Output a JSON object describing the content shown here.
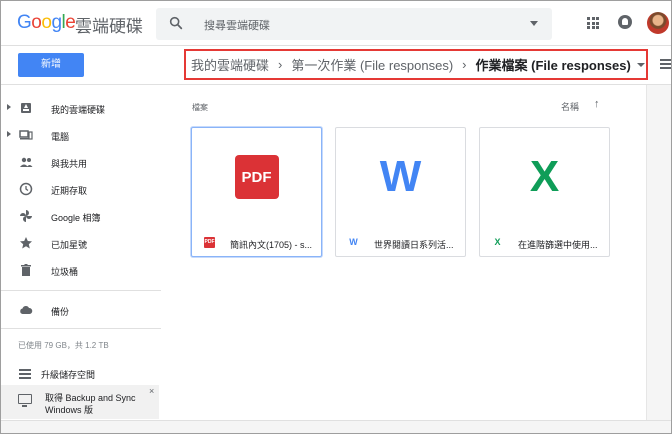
{
  "header": {
    "logo": "Google",
    "product": "雲端硬碟",
    "search_placeholder": "搜尋雲端硬碟"
  },
  "toolbar": {
    "new_label": "新增"
  },
  "breadcrumb": {
    "items": [
      "我的雲端硬碟",
      "第一次作業 (File responses)"
    ],
    "separator": "›",
    "current": "作業檔案 (File responses)"
  },
  "sidebar": {
    "items": [
      {
        "label": "我的雲端硬碟",
        "icon": "drive-icon"
      },
      {
        "label": "電腦",
        "icon": "computer-icon"
      },
      {
        "label": "與我共用",
        "icon": "shared-people-icon"
      },
      {
        "label": "近期存取",
        "icon": "clock-icon"
      },
      {
        "label": "Google 相簿",
        "icon": "photos-pinwheel-icon"
      },
      {
        "label": "已加星號",
        "icon": "star-icon"
      },
      {
        "label": "垃圾桶",
        "icon": "trash-icon"
      }
    ],
    "backup_label": "備份",
    "storage_usage": "已使用 79 GB，共 1.2 TB",
    "upgrade_label": "升級儲存空間",
    "promo_line1": "取得 Backup and Sync",
    "promo_line2": "Windows 版",
    "promo_close": "×"
  },
  "main": {
    "section_title": "檔案",
    "sort_label": "名稱",
    "sort_arrow": "↑",
    "files": [
      {
        "name": "簡訊內文(1705) - s...",
        "type": "pdf",
        "big_label": "PDF",
        "small_label": "PDF"
      },
      {
        "name": "世界閱讀日系列活...",
        "type": "word",
        "big_label": "W",
        "small_label": "W"
      },
      {
        "name": "在進階篩選中使用...",
        "type": "excel",
        "big_label": "X",
        "small_label": "X"
      }
    ]
  },
  "colors": {
    "accent": "#4285f4",
    "highlight_border": "#e53935",
    "pdf": "#db3236",
    "word": "#4285f4",
    "excel": "#0f9d58"
  }
}
